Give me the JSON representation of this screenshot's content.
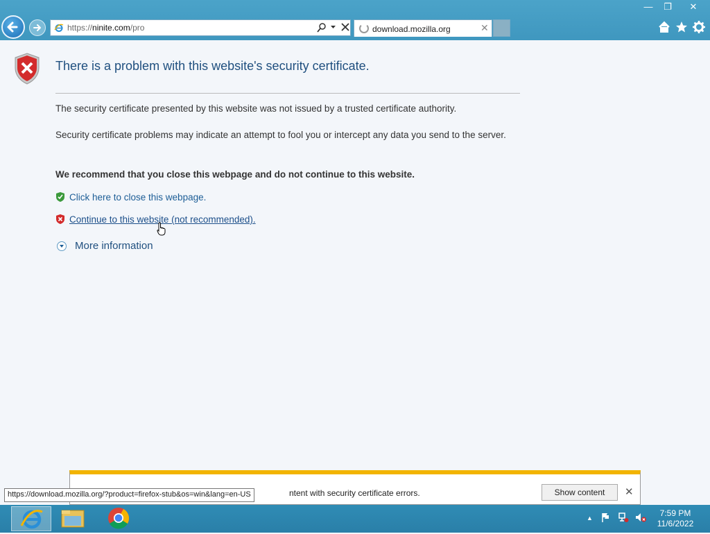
{
  "window": {
    "minimize_glyph": "—",
    "restore_glyph": "❐",
    "close_glyph": "✕"
  },
  "navbar": {
    "address_scheme": "https://",
    "address_host": "ninite.com",
    "address_path": "/pro",
    "tab_title": "download.mozilla.org",
    "tab_close_glyph": "✕",
    "icons": [
      "back-arrow-icon",
      "forward-arrow-icon",
      "ie-logo-icon",
      "search-icon",
      "dropdown-icon",
      "stop-icon",
      "home-icon",
      "favorites-star-icon",
      "settings-gear-icon"
    ]
  },
  "page": {
    "title": "There is a problem with this website's security certificate.",
    "p1": "The security certificate presented by this website was not issued by a trusted certificate authority.",
    "p2": "Security certificate problems may indicate an attempt to fool you or intercept any data you send to the server.",
    "recommendation": "We recommend that you close this webpage and do not continue to this website.",
    "close_link": "Click here to close this webpage.",
    "continue_link": "Continue to this website (not recommended).",
    "more_info": "More information"
  },
  "notification": {
    "text": "ntent with security certificate errors.",
    "show_button": "Show content",
    "close_glyph": "✕"
  },
  "status_url": "https://download.mozilla.org/?product=firefox-stub&os=win&lang=en-US",
  "taskbar": {
    "apps": [
      "internet-explorer",
      "file-explorer",
      "chrome"
    ],
    "time": "7:59 PM",
    "date": "11/6/2022"
  },
  "colors": {
    "chrome": "#3f97bf",
    "title": "#1f4f7f",
    "link": "#1c5d96",
    "warning_bar": "#f2b400",
    "error_red": "#d32b2b",
    "safe_green": "#3c9a3c"
  }
}
